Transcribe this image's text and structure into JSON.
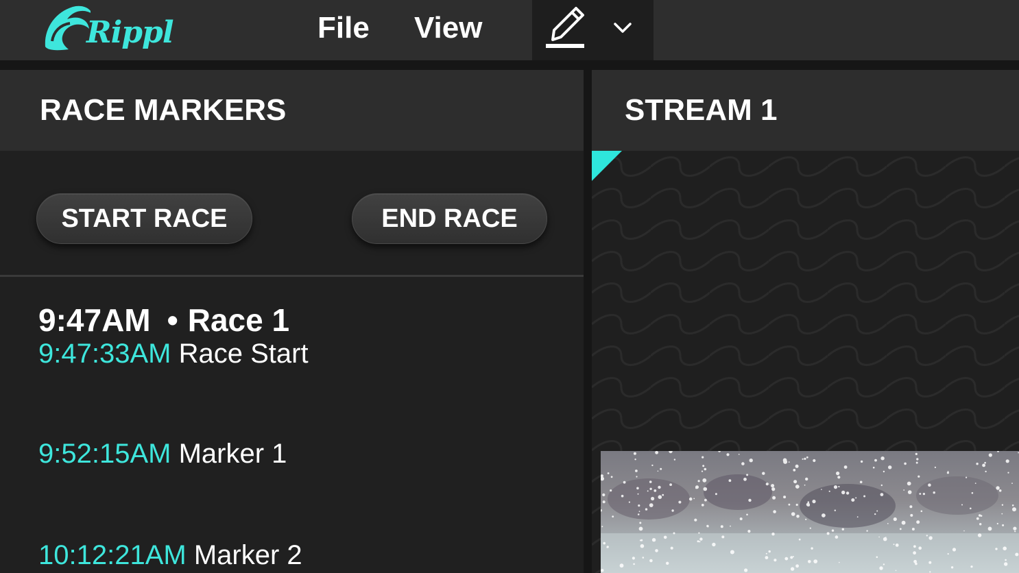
{
  "app": {
    "brand_name": "Rippl",
    "accent_color": "#3ee6dc"
  },
  "menu": {
    "file": "File",
    "view": "View"
  },
  "toolbar": {
    "pencil_icon": "pencil-icon",
    "dropdown_icon": "chevron-down-icon"
  },
  "race_markers": {
    "title": "RACE MARKERS",
    "start_button": "START RACE",
    "end_button": "END RACE",
    "race_heading": {
      "time": "9:47AM",
      "separator": "•",
      "name": "Race 1"
    },
    "markers": [
      {
        "time": "9:47:33AM",
        "label": "Race Start"
      },
      {
        "time": "9:52:15AM",
        "label": "Marker 1"
      },
      {
        "time": "10:12:21AM",
        "label": "Marker 2"
      }
    ]
  },
  "stream": {
    "title": "STREAM 1"
  }
}
